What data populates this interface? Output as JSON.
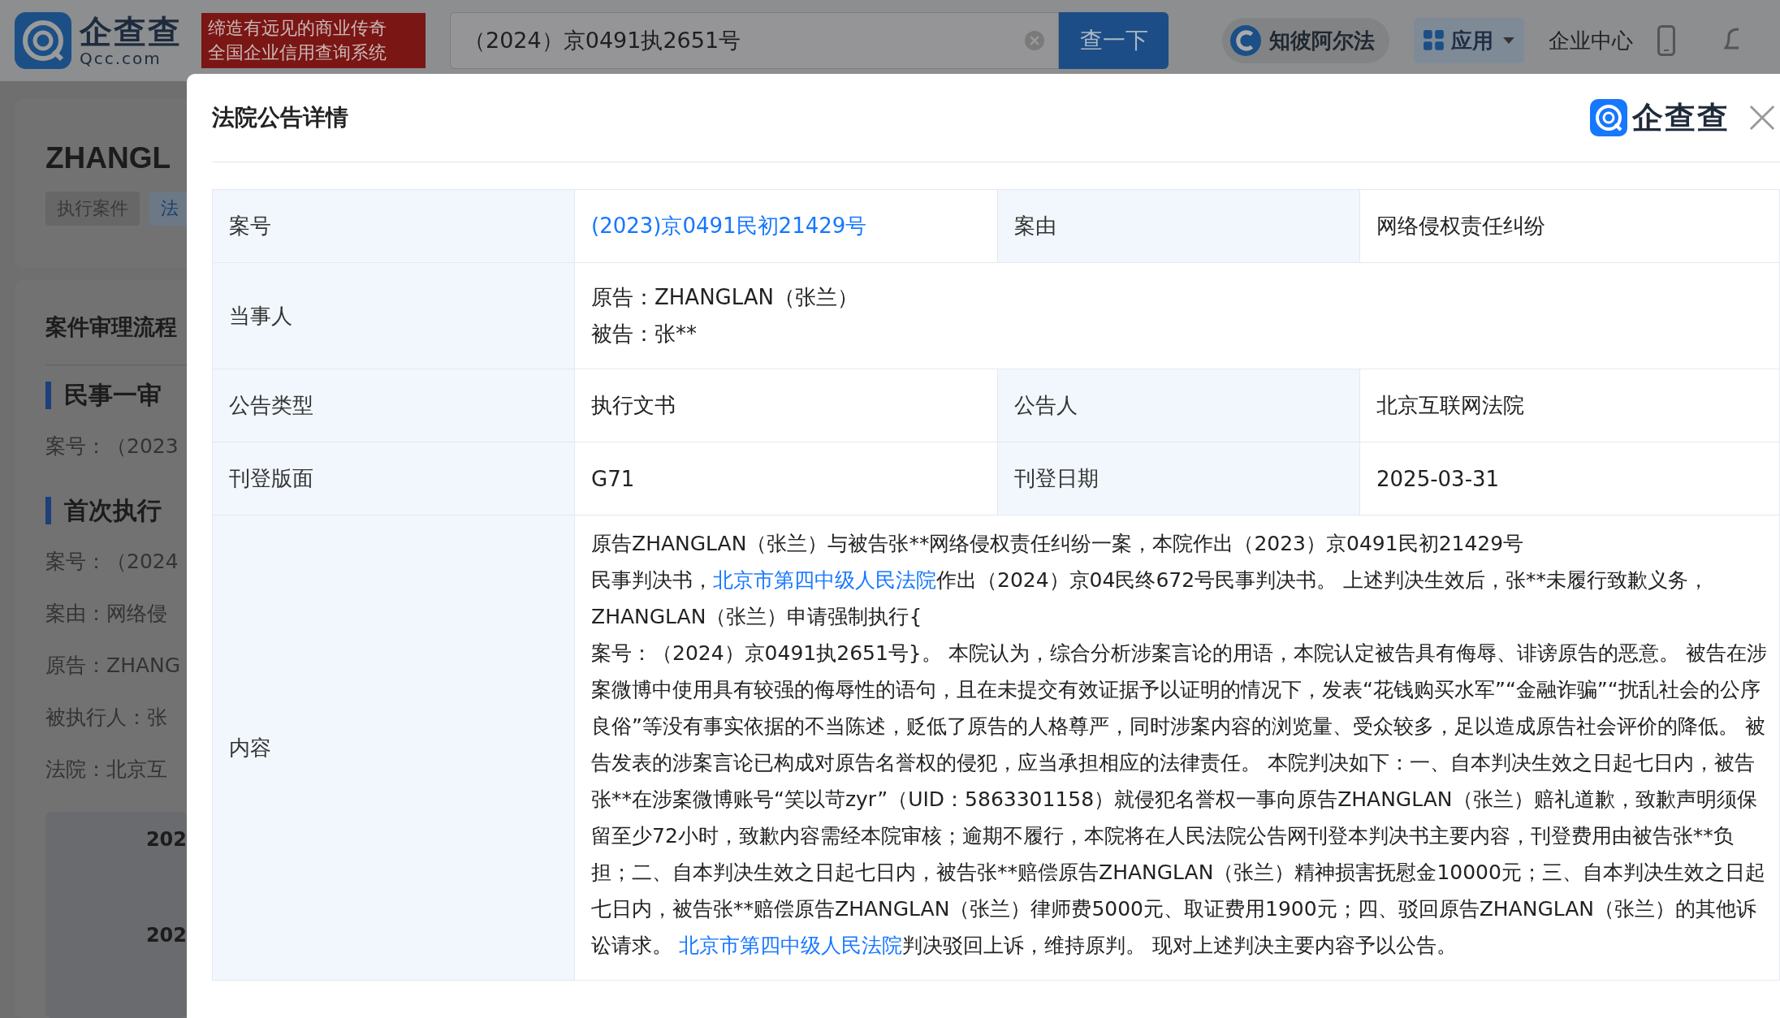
{
  "header": {
    "brand": "企查查",
    "domain": "Qcc.com",
    "slogan": [
      "缔造有远见的商业传奇",
      "全国企业信用查询系统"
    ],
    "search": {
      "value": "（2024）京0491执2651号"
    },
    "search_button": "查一下",
    "nav": [
      {
        "kind": "alpha",
        "label": "知彼阿尔法"
      },
      {
        "kind": "menu",
        "label": "应用"
      },
      {
        "kind": "plain",
        "label": "企业中心"
      }
    ]
  },
  "page": {
    "name": "ZHANGL",
    "tags": [
      {
        "label": "执行案件",
        "selected": false
      },
      {
        "label": "法",
        "selected": true
      }
    ],
    "section_title": "案件审理流程",
    "stages": [
      {
        "title": "民事一审",
        "lines": [
          "案号：（2023"
        ]
      },
      {
        "title": "首次执行",
        "lines": [
          "案号：（2024",
          "案由：网络侵",
          "原告：ZHANG",
          "被执行人：张",
          "法院：北京互"
        ]
      }
    ],
    "timeline": [
      "202",
      "202"
    ]
  },
  "modal": {
    "title": "法院公告详情",
    "brand": "企查查",
    "rows": [
      {
        "kind": "pair",
        "items": [
          {
            "label": "案号",
            "value": "(2023)京0491民初21429号",
            "link": true
          },
          {
            "label": "案由",
            "value": "网络侵权责任纠纷",
            "link": false
          }
        ]
      },
      {
        "kind": "lines",
        "label": "当事人",
        "lines": [
          "原告：ZHANGLAN（张兰）",
          "被告：张**"
        ]
      },
      {
        "kind": "pair",
        "items": [
          {
            "label": "公告类型",
            "value": "执行文书",
            "link": false
          },
          {
            "label": "公告人",
            "value": "北京互联网法院",
            "link": false
          }
        ]
      },
      {
        "kind": "pair",
        "items": [
          {
            "label": "刊登版面",
            "value": "G71",
            "link": false
          },
          {
            "label": "刊登日期",
            "value": "2025-03-31",
            "link": false
          }
        ]
      },
      {
        "kind": "text",
        "label": "内容",
        "paragraphs": [
          [
            {
              "text": "原告ZHANGLAN（张兰）与被告张**网络侵权责任纠纷一案，本院作出（2023）京0491民初21429号",
              "link": false
            }
          ],
          [
            {
              "text": "民事判决书，",
              "link": false
            },
            {
              "text": "北京市第四中级人民法院",
              "link": true
            },
            {
              "text": "作出（2024）京04民终672号民事判决书。 上述判决生效后，张**未履行致歉义务，ZHANGLAN（张兰）申请强制执行{",
              "link": false
            }
          ],
          [
            {
              "text": "案号：（2024）京0491执2651号}。 本院认为，综合分析涉案言论的用语，本院认定被告具有侮辱、诽谤原告的恶意。 被告在涉案微博中使用具有较强的侮辱性的语句，且在未提交有效证据予以证明的情况下，发表“花钱购买水军”“金融诈骗”“扰乱社会的公序良俗”等没有事实依据的不当陈述，贬低了原告的人格尊严，同时涉案内容的浏览量、受众较多，足以造成原告社会评价的降低。 被告发表的涉案言论已构成对原告名誉权的侵犯，应当承担相应的法律责任。 本院判决如下：一、自本判决生效之日起七日内，被告张**在涉案微博账号“笑以苛zyr”（UID：5863301158）就侵犯名誉权一事向原告ZHANGLAN（张兰）赔礼道歉，致歉声明须保留至少72小时，致歉内容需经本院审核；逾期不履行，本院将在人民法院公告网刊登本判决书主要内容，刊登费用由被告张**负担；二、自本判决生效之日起七日内，被告张**赔偿原告ZHANGLAN（张兰）精神损害抚慰金10000元；三、自本判决生效之日起七日内，被告张**赔偿原告ZHANGLAN（张兰）律师费5000元、取证费用1900元；四、驳回原告ZHANGLAN（张兰）的其他诉讼请求。 ",
              "link": false
            },
            {
              "text": "北京市第四中级人民法院",
              "link": true
            },
            {
              "text": "判决驳回上诉，维持原判。 现对上述判决主要内容予以公告。",
              "link": false
            }
          ]
        ]
      }
    ]
  }
}
